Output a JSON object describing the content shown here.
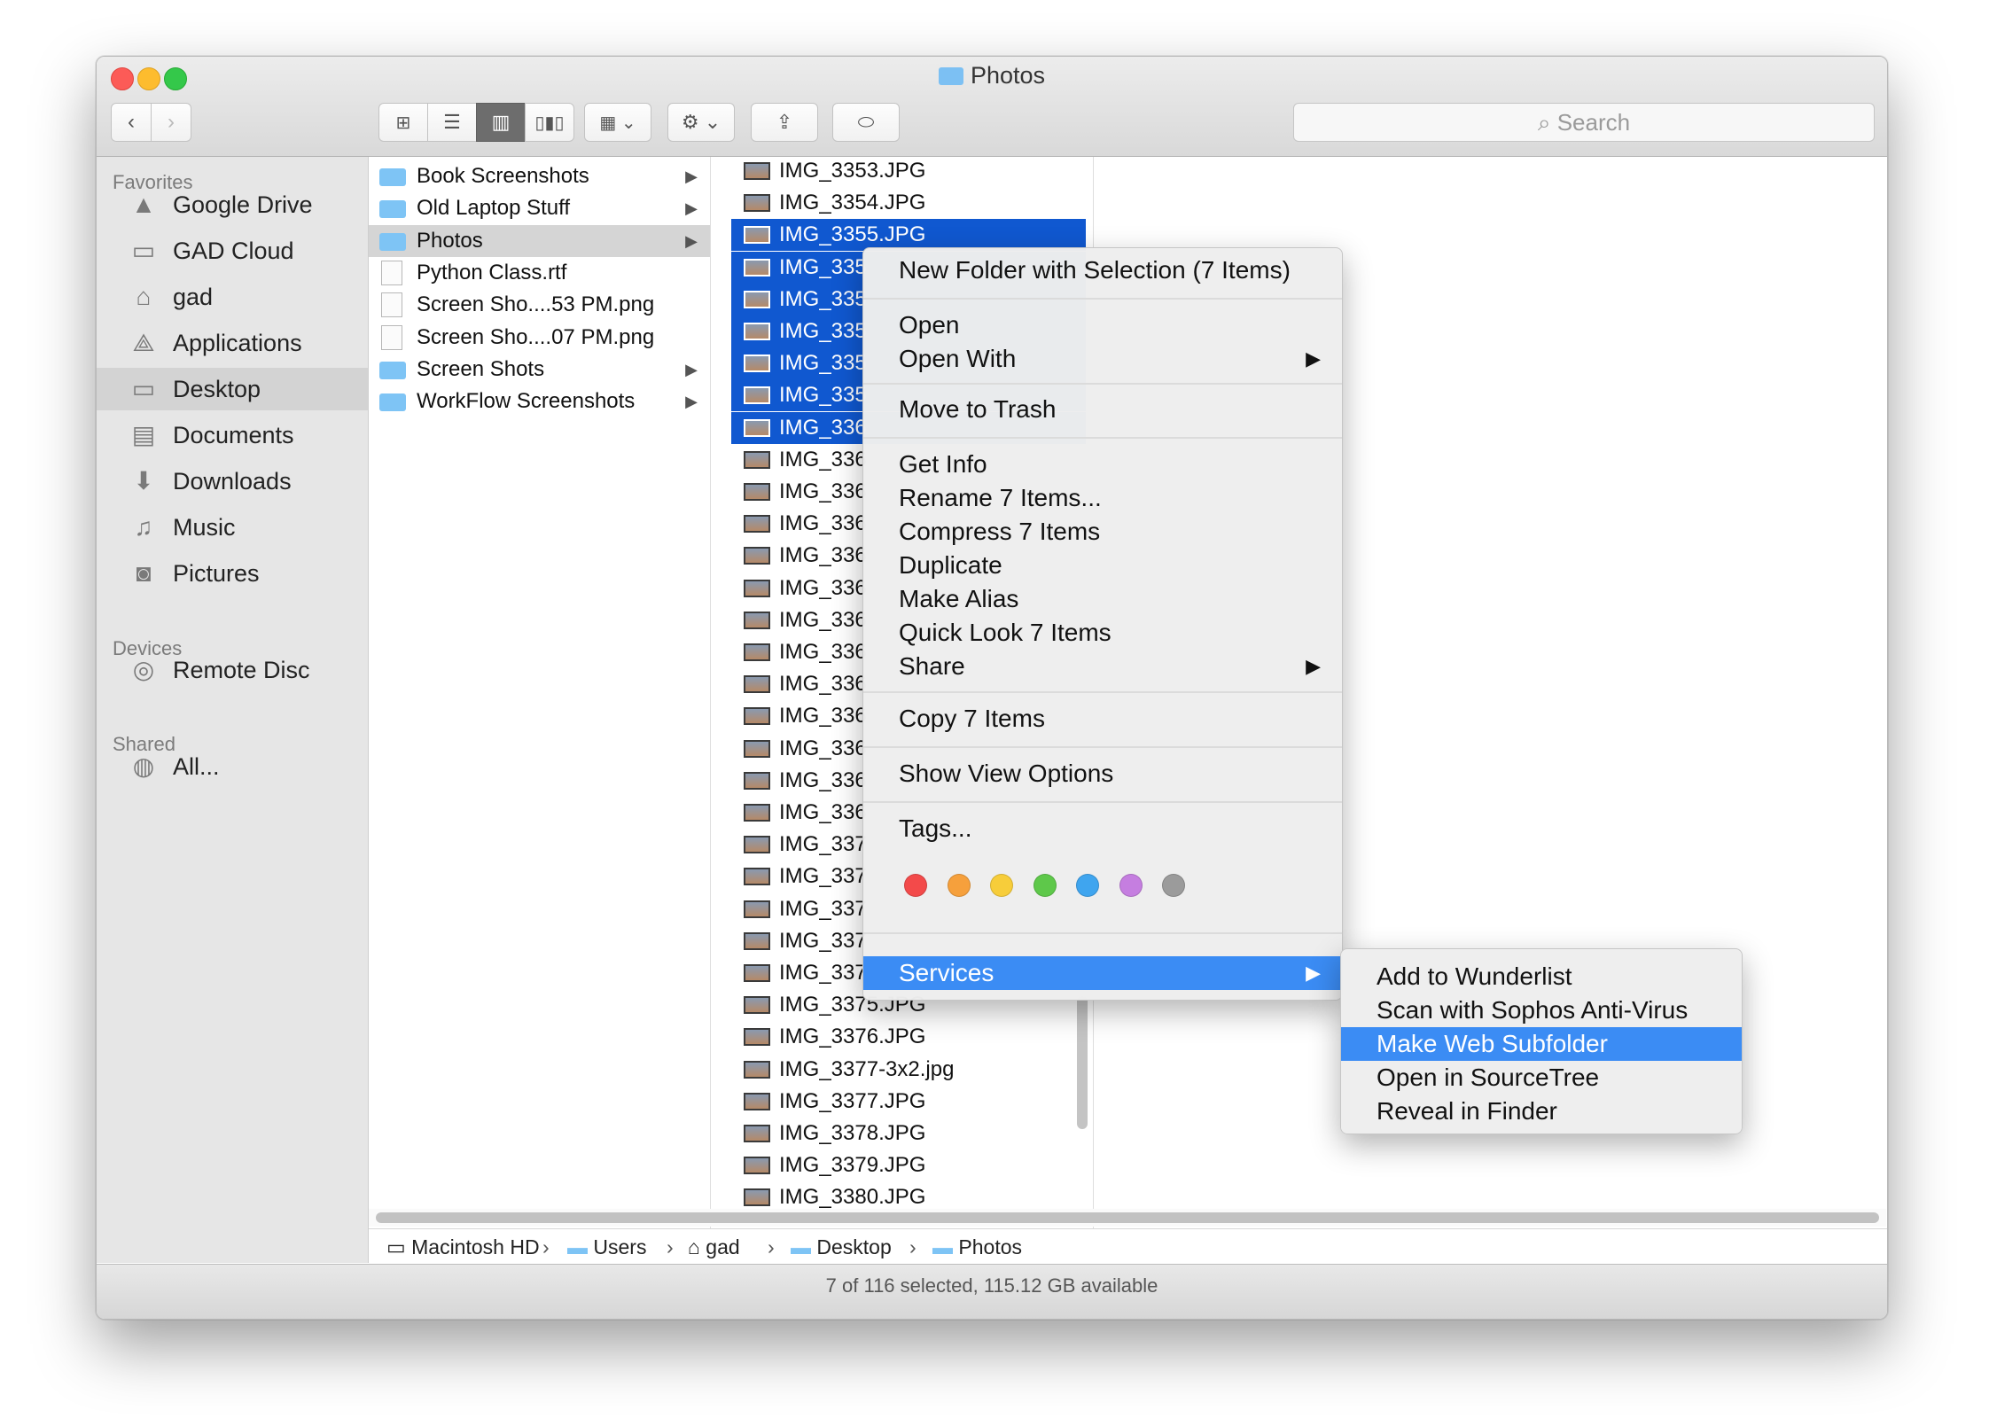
{
  "window": {
    "title": "Photos"
  },
  "toolbar": {
    "back_icon": "chevron-left-icon",
    "forward_icon": "chevron-right-icon",
    "view_modes": [
      "icon-view",
      "list-view",
      "column-view",
      "cover-flow-view"
    ],
    "active_view": "column-view",
    "search_placeholder": "Search"
  },
  "sidebar": {
    "sections": [
      {
        "title": "Favorites",
        "items": [
          {
            "label": "Google Drive",
            "icon": "google-drive-icon"
          },
          {
            "label": "GAD Cloud",
            "icon": "folder-icon"
          },
          {
            "label": "gad",
            "icon": "home-icon"
          },
          {
            "label": "Applications",
            "icon": "applications-icon"
          },
          {
            "label": "Desktop",
            "icon": "desktop-icon",
            "active": true
          },
          {
            "label": "Documents",
            "icon": "documents-icon"
          },
          {
            "label": "Downloads",
            "icon": "downloads-icon"
          },
          {
            "label": "Music",
            "icon": "music-icon"
          },
          {
            "label": "Pictures",
            "icon": "camera-icon"
          }
        ]
      },
      {
        "title": "Devices",
        "items": [
          {
            "label": "Remote Disc",
            "icon": "disc-icon"
          }
        ]
      },
      {
        "title": "Shared",
        "items": [
          {
            "label": "All...",
            "icon": "network-icon"
          }
        ]
      }
    ]
  },
  "column1": [
    {
      "name": "Book Screenshots",
      "type": "folder",
      "has_children": true
    },
    {
      "name": "Old Laptop Stuff",
      "type": "folder",
      "has_children": true
    },
    {
      "name": "Photos",
      "type": "folder",
      "has_children": true,
      "selected": true
    },
    {
      "name": "Python Class.rtf",
      "type": "file"
    },
    {
      "name": "Screen Sho....53 PM.png",
      "type": "image"
    },
    {
      "name": "Screen Sho....07 PM.png",
      "type": "image"
    },
    {
      "name": "Screen Shots",
      "type": "folder",
      "has_children": true
    },
    {
      "name": "WorkFlow Screenshots",
      "type": "folder",
      "has_children": true
    }
  ],
  "column2": [
    {
      "name": "IMG_3353.JPG"
    },
    {
      "name": "IMG_3354.JPG"
    },
    {
      "name": "IMG_3355.JPG",
      "selected": true
    },
    {
      "name": "IMG_335",
      "selected": true
    },
    {
      "name": "IMG_335",
      "selected": true
    },
    {
      "name": "IMG_335",
      "selected": true
    },
    {
      "name": "IMG_335",
      "selected": true
    },
    {
      "name": "IMG_335",
      "selected": true
    },
    {
      "name": "IMG_336",
      "selected": true
    },
    {
      "name": "IMG_336"
    },
    {
      "name": "IMG_336"
    },
    {
      "name": "IMG_336"
    },
    {
      "name": "IMG_336"
    },
    {
      "name": "IMG_336"
    },
    {
      "name": "IMG_336"
    },
    {
      "name": "IMG_336"
    },
    {
      "name": "IMG_336"
    },
    {
      "name": "IMG_336"
    },
    {
      "name": "IMG_336"
    },
    {
      "name": "IMG_336"
    },
    {
      "name": "IMG_336"
    },
    {
      "name": "IMG_337"
    },
    {
      "name": "IMG_337"
    },
    {
      "name": "IMG_337"
    },
    {
      "name": "IMG_337"
    },
    {
      "name": "IMG_337"
    },
    {
      "name": "IMG_3375.JPG"
    },
    {
      "name": "IMG_3376.JPG"
    },
    {
      "name": "IMG_3377-3x2.jpg"
    },
    {
      "name": "IMG_3377.JPG"
    },
    {
      "name": "IMG_3378.JPG"
    },
    {
      "name": "IMG_3379.JPG"
    },
    {
      "name": "IMG_3380.JPG"
    }
  ],
  "context_menu": {
    "groups": [
      [
        {
          "label": "New Folder with Selection (7 Items)"
        }
      ],
      [
        {
          "label": "Open"
        },
        {
          "label": "Open With",
          "submenu": true
        }
      ],
      [
        {
          "label": "Move to Trash"
        }
      ],
      [
        {
          "label": "Get Info"
        },
        {
          "label": "Rename 7 Items..."
        },
        {
          "label": "Compress 7 Items"
        },
        {
          "label": "Duplicate"
        },
        {
          "label": "Make Alias"
        },
        {
          "label": "Quick Look 7 Items"
        },
        {
          "label": "Share",
          "submenu": true
        }
      ],
      [
        {
          "label": "Copy 7 Items"
        }
      ],
      [
        {
          "label": "Show View Options"
        }
      ],
      [
        {
          "label": "Tags..."
        }
      ],
      [
        {
          "label": "Services",
          "submenu": true,
          "highlighted": true
        }
      ]
    ],
    "tag_colors": [
      "#f34a4a",
      "#f6a03c",
      "#f7cd3a",
      "#5ec84a",
      "#3fa5ef",
      "#c57ee0",
      "#9b9b9b"
    ]
  },
  "services_submenu": [
    {
      "label": "Add to Wunderlist"
    },
    {
      "label": "Scan with Sophos Anti-Virus"
    },
    {
      "label": "Make Web Subfolder",
      "highlighted": true
    },
    {
      "label": "Open in SourceTree"
    },
    {
      "label": "Reveal in Finder"
    }
  ],
  "pathbar": [
    {
      "label": "Macintosh HD",
      "icon": "hard-drive-icon"
    },
    {
      "label": "Users",
      "icon": "folder-icon"
    },
    {
      "label": "gad",
      "icon": "home-icon"
    },
    {
      "label": "Desktop",
      "icon": "folder-icon"
    },
    {
      "label": "Photos",
      "icon": "folder-icon"
    }
  ],
  "status": "7 of 116 selected, 115.12 GB available",
  "colors": {
    "selection": "#1058d0",
    "menu_highlight": "#3b8cf4",
    "folder": "#7ec4f5"
  }
}
